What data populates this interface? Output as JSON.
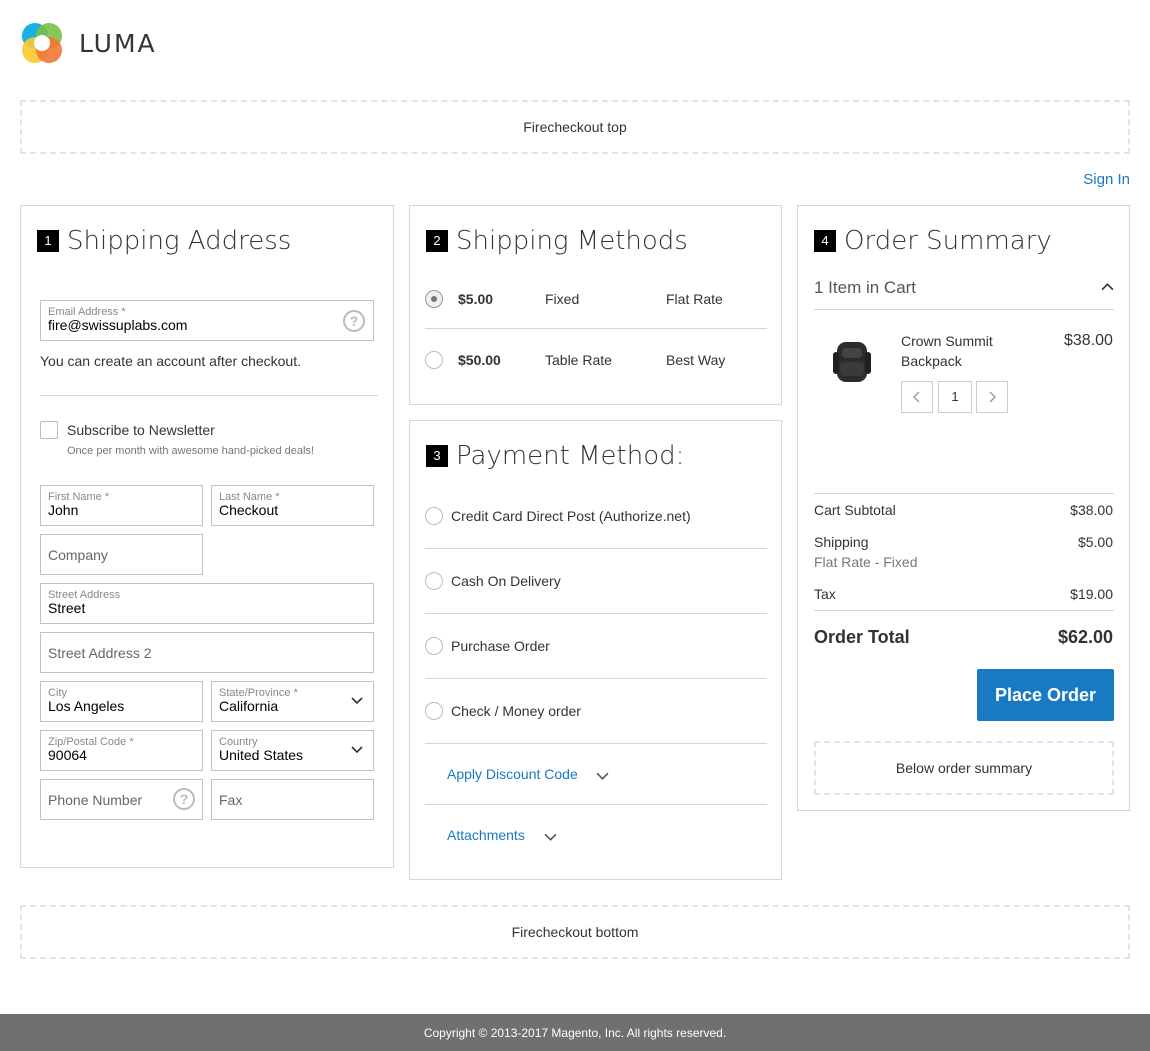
{
  "header": {
    "logo_text": "LUMA"
  },
  "top_block": "Firecheckout top",
  "bottom_block": "Firecheckout bottom",
  "signin": "Sign In",
  "shipping_address": {
    "step": "1",
    "title": "Shipping Address",
    "email": {
      "label": "Email Address *",
      "value": "fire@swissuplabs.com"
    },
    "account_note": "You can create an account after checkout.",
    "newsletter": {
      "label": "Subscribe to Newsletter",
      "note": "Once per month with awesome hand-picked deals!"
    },
    "first_name": {
      "label": "First Name *",
      "value": "John"
    },
    "last_name": {
      "label": "Last Name *",
      "value": "Checkout"
    },
    "company": {
      "placeholder": "Company"
    },
    "street": {
      "label": "Street Address",
      "value": "Street"
    },
    "street2": {
      "placeholder": "Street Address 2"
    },
    "city": {
      "label": "City",
      "value": "Los Angeles"
    },
    "state": {
      "label": "State/Province *",
      "value": "California"
    },
    "zip": {
      "label": "Zip/Postal Code *",
      "value": "90064"
    },
    "country": {
      "label": "Country",
      "value": "United States"
    },
    "phone": {
      "placeholder": "Phone Number"
    },
    "fax": {
      "placeholder": "Fax"
    }
  },
  "shipping_methods": {
    "step": "2",
    "title": "Shipping Methods",
    "methods": [
      {
        "price": "$5.00",
        "method": "Fixed",
        "carrier": "Flat Rate",
        "selected": true
      },
      {
        "price": "$50.00",
        "method": "Table Rate",
        "carrier": "Best Way",
        "selected": false
      }
    ]
  },
  "payment": {
    "step": "3",
    "title": "Payment Method:",
    "methods": [
      "Credit Card Direct Post (Authorize.net)",
      "Cash On Delivery",
      "Purchase Order",
      "Check / Money order"
    ],
    "discount_link": "Apply Discount Code",
    "attachments_link": "Attachments"
  },
  "summary": {
    "step": "4",
    "title": "Order Summary",
    "items_in_cart": "1 Item in Cart",
    "item": {
      "name_line1": "Crown Summit",
      "name_line2": "Backpack",
      "price": "$38.00",
      "qty": "1"
    },
    "subtotal_label": "Cart Subtotal",
    "subtotal": "$38.00",
    "shipping_label": "Shipping",
    "shipping_method": "Flat Rate - Fixed",
    "shipping": "$5.00",
    "tax_label": "Tax",
    "tax": "$19.00",
    "total_label": "Order Total",
    "total": "$62.00",
    "place_order": "Place Order",
    "below_block": "Below order summary"
  },
  "footer": "Copyright © 2013-2017 Magento, Inc. All rights reserved.",
  "colors": {
    "accent": "#1979c3",
    "footer_bg": "#6e716e"
  }
}
